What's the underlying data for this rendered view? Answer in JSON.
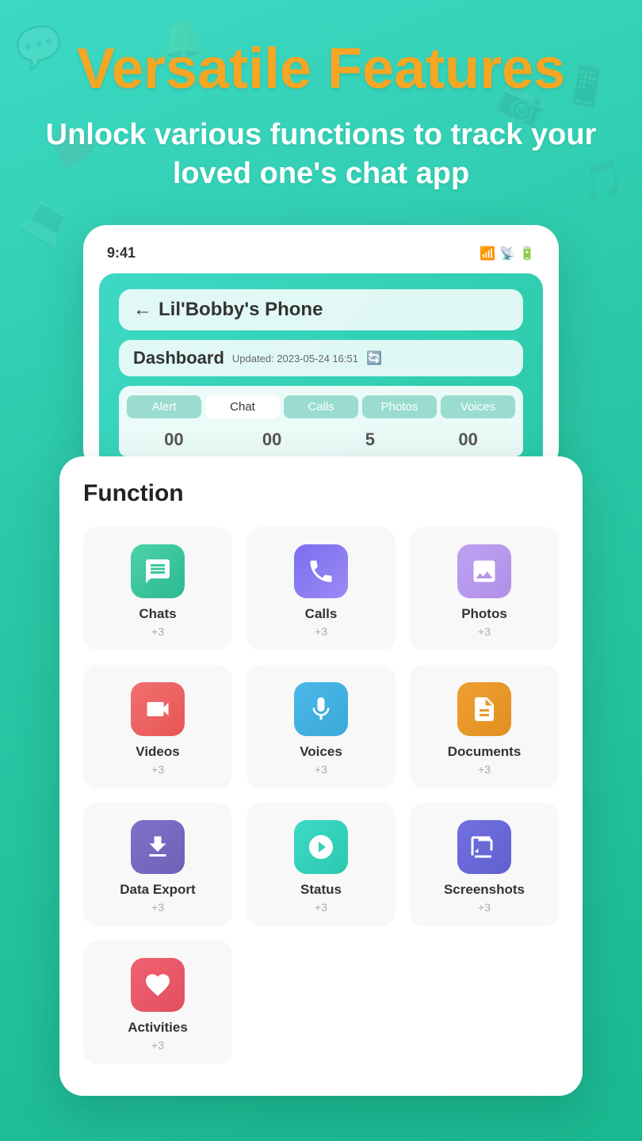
{
  "page": {
    "main_title": "Versatile Features",
    "subtitle": "Unlock various functions to track your loved one's chat app"
  },
  "phone": {
    "time": "9:41",
    "device_name": "Lil'Bobby's Phone",
    "dashboard_label": "Dashboard",
    "updated_text": "Updated: 2023-05-24 16:51",
    "tabs": [
      "Alert",
      "Chat",
      "Calls",
      "Photos",
      "Voices"
    ],
    "numbers": [
      "00",
      "00",
      "5",
      "00"
    ]
  },
  "function_panel": {
    "title": "Function",
    "items": [
      {
        "id": "chats",
        "label": "Chats",
        "count": "+3",
        "icon_class": "icon-chat"
      },
      {
        "id": "calls",
        "label": "Calls",
        "count": "+3",
        "icon_class": "icon-calls"
      },
      {
        "id": "photos",
        "label": "Photos",
        "count": "+3",
        "icon_class": "icon-photos"
      },
      {
        "id": "videos",
        "label": "Videos",
        "count": "+3",
        "icon_class": "icon-videos"
      },
      {
        "id": "voices",
        "label": "Voices",
        "count": "+3",
        "icon_class": "icon-voices"
      },
      {
        "id": "documents",
        "label": "Documents",
        "count": "+3",
        "icon_class": "icon-documents"
      },
      {
        "id": "data-export",
        "label": "Data Export",
        "count": "+3",
        "icon_class": "icon-export"
      },
      {
        "id": "status",
        "label": "Status",
        "count": "+3",
        "icon_class": "icon-status"
      },
      {
        "id": "screenshots",
        "label": "Screenshots",
        "count": "+3",
        "icon_class": "icon-screenshots"
      },
      {
        "id": "activities",
        "label": "Activities",
        "count": "+3",
        "icon_class": "icon-activities"
      }
    ]
  },
  "colors": {
    "title_color": "#f5a623",
    "background_start": "#3dd9c5",
    "background_end": "#1ab890"
  }
}
